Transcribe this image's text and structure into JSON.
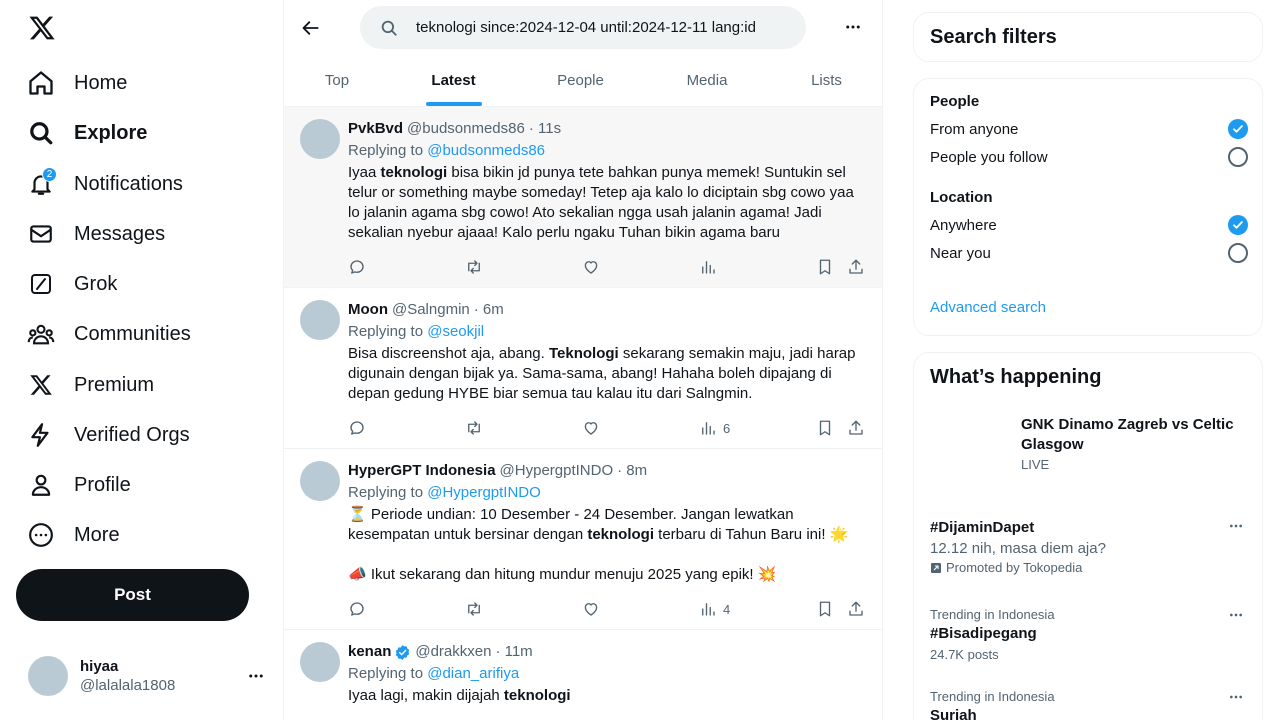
{
  "sidebar": {
    "items": [
      {
        "label": "Home",
        "icon": "home-icon"
      },
      {
        "label": "Explore",
        "icon": "search-icon"
      },
      {
        "label": "Notifications",
        "icon": "bell-icon",
        "badge": "2"
      },
      {
        "label": "Messages",
        "icon": "envelope-icon"
      },
      {
        "label": "Grok",
        "icon": "grok-icon"
      },
      {
        "label": "Communities",
        "icon": "communities-icon"
      },
      {
        "label": "Premium",
        "icon": "x-logo-icon"
      },
      {
        "label": "Verified Orgs",
        "icon": "lightning-icon"
      },
      {
        "label": "Profile",
        "icon": "person-icon"
      },
      {
        "label": "More",
        "icon": "more-circle-icon"
      }
    ],
    "post_label": "Post",
    "account": {
      "name": "hiyaa",
      "handle": "@lalalala1808"
    }
  },
  "search": {
    "value": "teknologi since:2024-12-04 until:2024-12-11 lang:id"
  },
  "tabs": [
    "Top",
    "Latest",
    "People",
    "Media",
    "Lists"
  ],
  "active_tab": "Latest",
  "tweets": [
    {
      "name": "PvkBvd",
      "handle": "@budsonmeds86",
      "time": "· 11s",
      "replying_prefix": "Replying to ",
      "replying_to": "@budsonmeds86",
      "text_before": "Iyaa ",
      "keyword": "teknologi",
      "text_after": " bisa bikin jd punya tete bahkan punya memek! Suntukin sel telur or something maybe someday! Tetep aja kalo lo diciptain sbg cowo yaa lo jalanin agama sbg cowo! Ato sekalian ngga usah jalanin agama! Jadi sekalian nyebur ajaaa! Kalo perlu ngaku Tuhan bikin agama baru",
      "views": ""
    },
    {
      "name": "Moon",
      "handle": "@Salngmin",
      "time": "· 6m",
      "replying_prefix": "Replying to ",
      "replying_to": "@seokjil",
      "text_before": "Bisa discreenshot aja, abang. ",
      "keyword": "Teknologi",
      "text_after": " sekarang semakin maju, jadi harap digunain dengan bijak ya. Sama-sama, abang! Hahaha boleh dipajang di depan gedung HYBE biar semua tau kalau itu dari Salngmin.",
      "views": "6"
    },
    {
      "name": "HyperGPT Indonesia",
      "handle": "@HypergptINDO",
      "time": "· 8m",
      "replying_prefix": "Replying to ",
      "replying_to": "@HypergptINDO",
      "text_before": "⏳ Periode undian: 10 Desember - 24 Desember. Jangan lewatkan kesempatan untuk bersinar dengan ",
      "keyword": "teknologi",
      "text_after": " terbaru di Tahun Baru ini! 🌟",
      "text_extra": "📣 Ikut sekarang dan hitung mundur menuju 2025 yang epik! 💥",
      "views": "4"
    },
    {
      "name": "kenan",
      "handle": "@drakkxen",
      "time": "· 11m",
      "replying_prefix": "Replying to ",
      "replying_to": "@dian_arifiya",
      "text_before": "Iyaa lagi, makin dijajah ",
      "keyword": "teknologi",
      "text_after": "",
      "verified": true
    }
  ],
  "search_filters": {
    "title": "Search filters",
    "people_heading": "People",
    "people_options": [
      "From anyone",
      "People you follow"
    ],
    "people_selected": "From anyone",
    "location_heading": "Location",
    "location_options": [
      "Anywhere",
      "Near you"
    ],
    "location_selected": "Anywhere",
    "advanced_label": "Advanced search"
  },
  "happening": {
    "title": "What’s happening",
    "event": {
      "title": "GNK Dinamo Zagreb vs Celtic Glasgow",
      "status": "LIVE"
    },
    "trends": [
      {
        "title": "#DijaminDapet",
        "subtitle": "12.12 nih, masa diem aja?",
        "promo": "Promoted by Tokopedia"
      },
      {
        "meta": "Trending in Indonesia",
        "title": "#Bisadipegang",
        "posts": "24.7K posts"
      },
      {
        "meta": "Trending in Indonesia",
        "title": "Suriah"
      }
    ]
  },
  "colors": {
    "accent": "#1d9bf0",
    "text": "#0f1419",
    "muted": "#536471",
    "border": "#eff3f4"
  }
}
